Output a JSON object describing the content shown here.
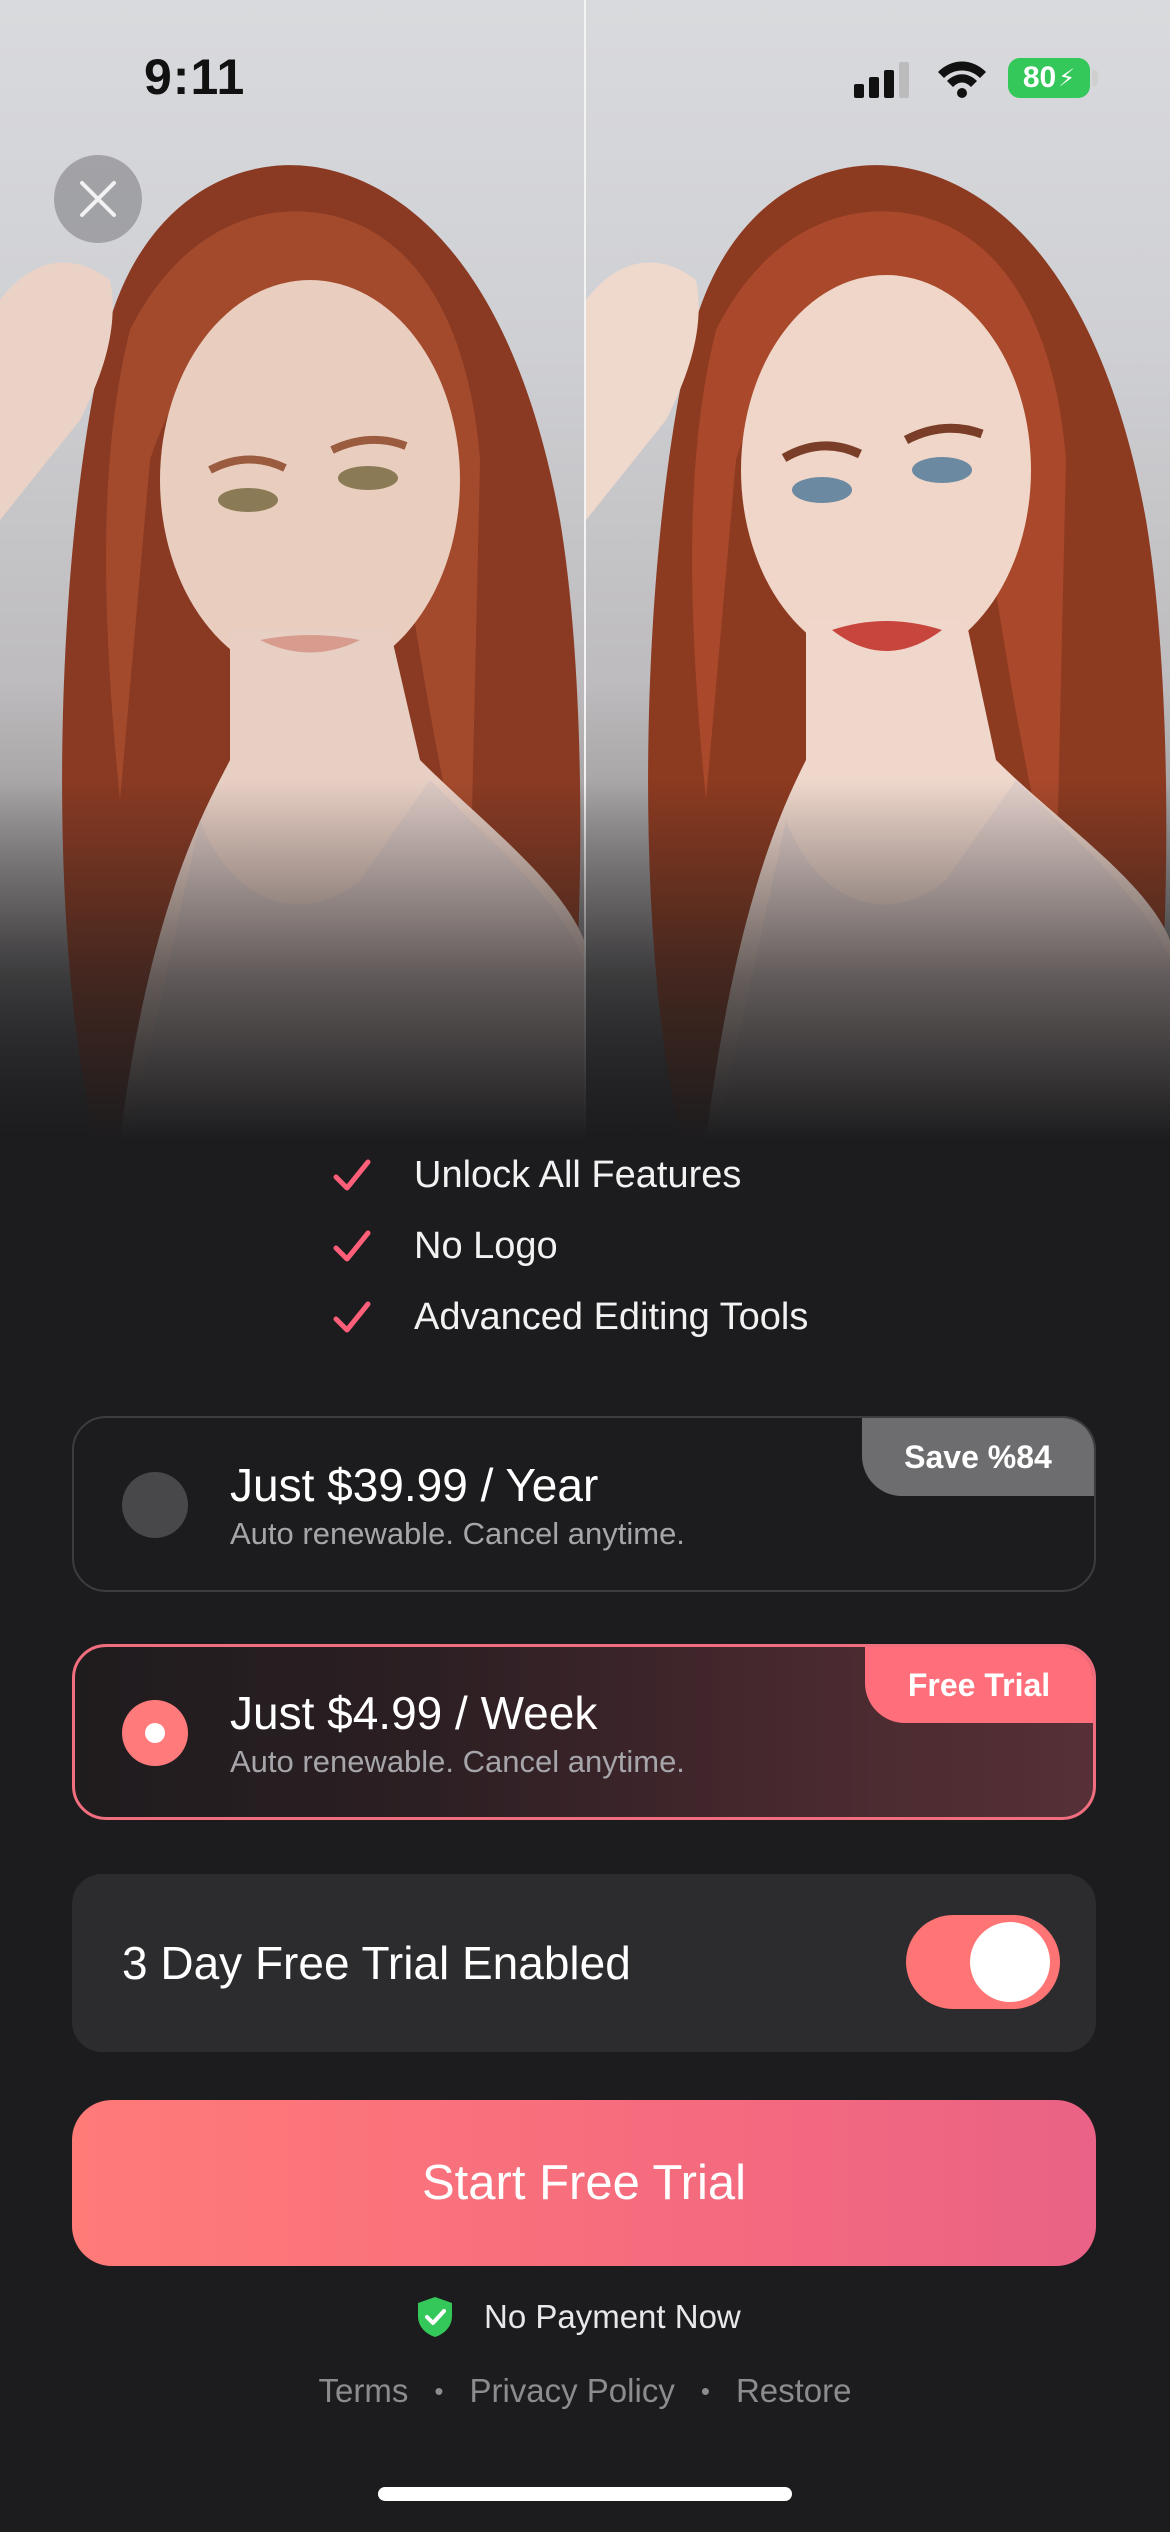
{
  "status_bar": {
    "time": "9:11",
    "battery": "80"
  },
  "features": [
    {
      "label": "Unlock All Features"
    },
    {
      "label": "No Logo"
    },
    {
      "label": "Advanced Editing Tools"
    }
  ],
  "plans": {
    "year": {
      "title": "Just $39.99 / Year",
      "subtitle": "Auto renewable. Cancel anytime.",
      "badge": "Save %84",
      "selected": false
    },
    "week": {
      "title": "Just $4.99 / Week",
      "subtitle": "Auto renewable. Cancel anytime.",
      "badge": "Free Trial",
      "selected": true
    }
  },
  "trial_toggle": {
    "label": "3 Day Free Trial Enabled",
    "enabled": true
  },
  "cta": {
    "label": "Start Free Trial"
  },
  "no_payment": {
    "label": "No Payment Now"
  },
  "footer": {
    "terms": "Terms",
    "privacy": "Privacy Policy",
    "restore": "Restore",
    "separator": "•"
  },
  "colors": {
    "accent": "#ff7575",
    "background": "#1c1c1e",
    "check": "#ff5f79",
    "shield": "#34c759"
  },
  "icons": {
    "close": "close-icon",
    "check": "checkmark-icon",
    "shield": "shield-check-icon"
  }
}
